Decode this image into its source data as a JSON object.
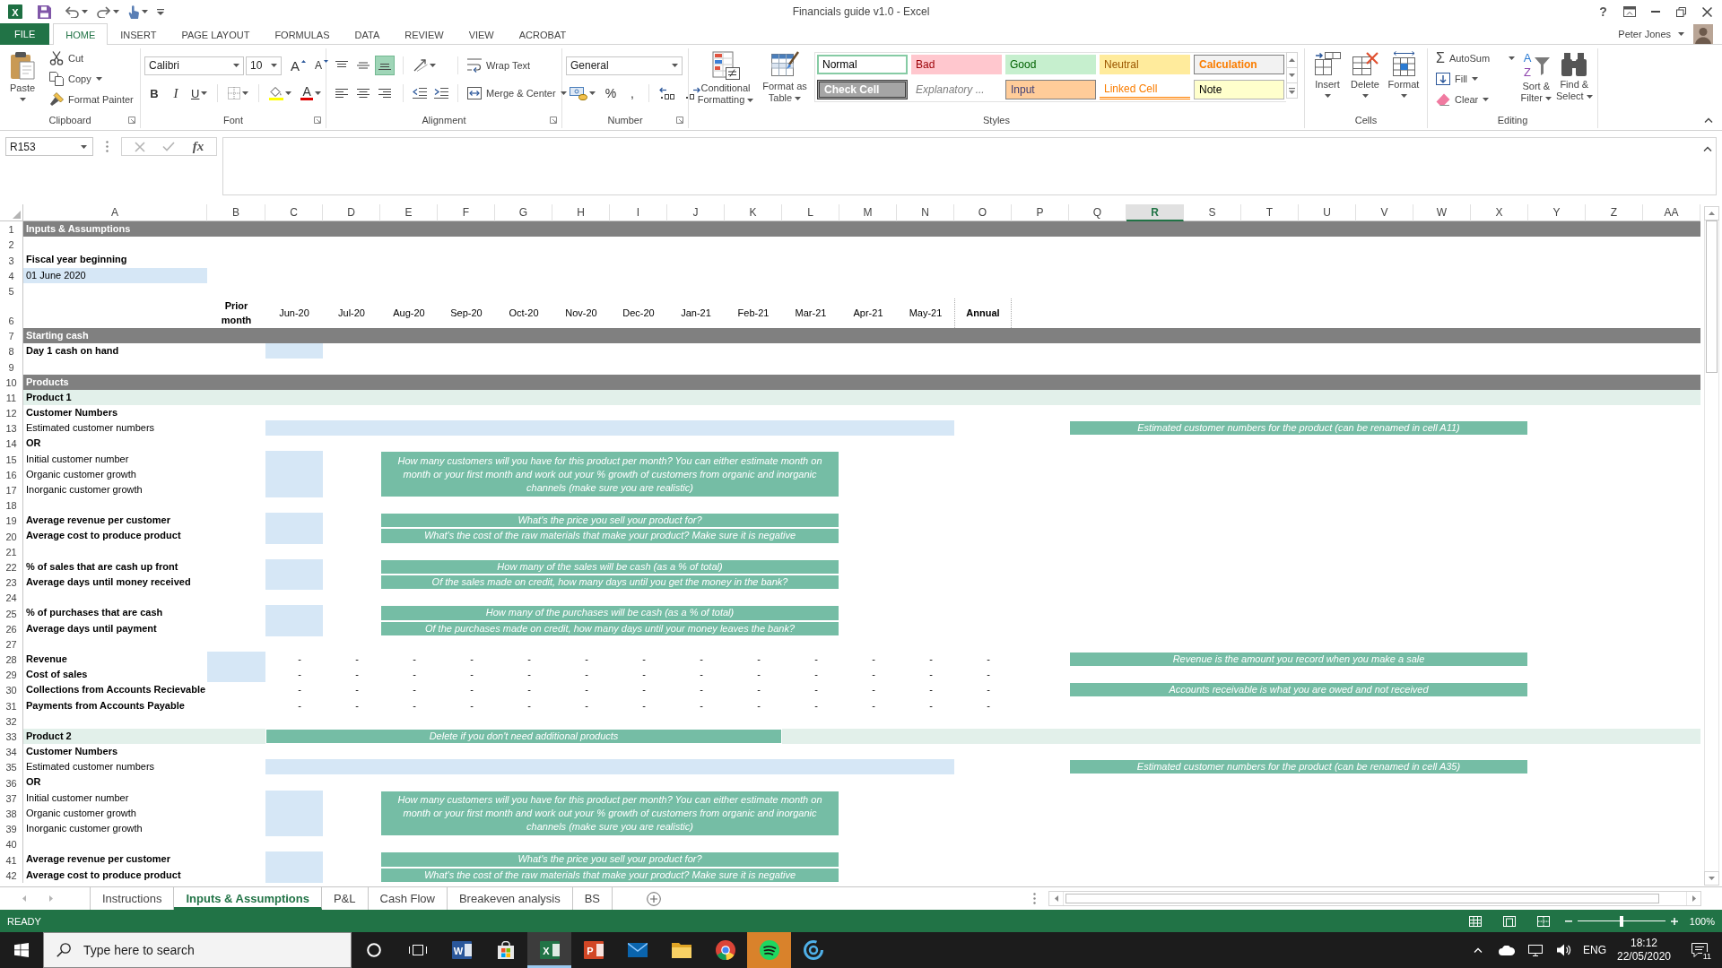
{
  "window": {
    "app_glyph": "X",
    "title": "Financials guide v1.0 - Excel",
    "help": "?"
  },
  "ribbon": {
    "tabs": [
      {
        "label": "FILE",
        "kind": "file",
        "selected": false
      },
      {
        "label": "HOME",
        "kind": "tab",
        "selected": true
      },
      {
        "label": "INSERT",
        "kind": "tab",
        "selected": false
      },
      {
        "label": "PAGE LAYOUT",
        "kind": "tab",
        "selected": false
      },
      {
        "label": "FORMULAS",
        "kind": "tab",
        "selected": false
      },
      {
        "label": "DATA",
        "kind": "tab",
        "selected": false
      },
      {
        "label": "REVIEW",
        "kind": "tab",
        "selected": false
      },
      {
        "label": "VIEW",
        "kind": "tab",
        "selected": false
      },
      {
        "label": "ACROBAT",
        "kind": "tab",
        "selected": false
      }
    ],
    "user": "Peter Jones",
    "clipboard": {
      "label": "Clipboard",
      "paste": "Paste",
      "cut": "Cut",
      "copy": "Copy",
      "format_painter": "Format Painter"
    },
    "font": {
      "label": "Font",
      "family": "Calibri",
      "size": "10",
      "grow_glyph": "A",
      "shrink_glyph": "A",
      "bold_glyph": "B",
      "italic_glyph": "I",
      "underline_glyph": "U",
      "font_color_glyph": "A"
    },
    "alignment": {
      "label": "Alignment",
      "vertical": [
        {
          "selected": false
        },
        {
          "selected": false
        },
        {
          "selected": true
        }
      ],
      "horizontal": [
        {
          "selected": false
        },
        {
          "selected": false
        },
        {
          "selected": false
        }
      ],
      "wrap_text": "Wrap Text",
      "merge_center": "Merge & Center"
    },
    "number": {
      "label": "Number",
      "format": "General",
      "percent": "%",
      "comma": ","
    },
    "styles": {
      "label": "Styles",
      "conditional_formatting": "Conditional Formatting",
      "format_as_table": "Format as Table",
      "cell_styles": [
        {
          "label": "Normal",
          "kind": "normal",
          "selected": true
        },
        {
          "label": "Bad",
          "kind": "bad",
          "selected": false
        },
        {
          "label": "Good",
          "kind": "good",
          "selected": false
        },
        {
          "label": "Neutral",
          "kind": "neutral",
          "selected": false
        },
        {
          "label": "Calculation",
          "kind": "calculation",
          "selected": false
        },
        {
          "label": "Check Cell",
          "kind": "check",
          "selected": false
        },
        {
          "label": "Explanatory ...",
          "kind": "explanatory",
          "selected": false
        },
        {
          "label": "Input",
          "kind": "input",
          "selected": false
        },
        {
          "label": "Linked Cell",
          "kind": "linked",
          "selected": false
        },
        {
          "label": "Note",
          "kind": "note",
          "selected": false
        }
      ]
    },
    "cells": {
      "label": "Cells",
      "insert": "Insert",
      "delete": "Delete",
      "format": "Format"
    },
    "editing": {
      "label": "Editing",
      "sum_glyph": "Σ",
      "autosum": "AutoSum",
      "fill": "Fill",
      "clear": "Clear",
      "sort_filter": "Sort & Filter",
      "sort_glyphs": [
        "A",
        "Z"
      ],
      "find_select": "Find & Select"
    }
  },
  "formula_bar": {
    "name_box": "R153",
    "fx_glyph": "fx"
  },
  "sheet": {
    "columns": [
      {
        "label": "A",
        "selected": false
      },
      {
        "label": "B",
        "selected": false
      },
      {
        "label": "C",
        "selected": false
      },
      {
        "label": "D",
        "selected": false
      },
      {
        "label": "E",
        "selected": false
      },
      {
        "label": "F",
        "selected": false
      },
      {
        "label": "G",
        "selected": false
      },
      {
        "label": "H",
        "selected": false
      },
      {
        "label": "I",
        "selected": false
      },
      {
        "label": "J",
        "selected": false
      },
      {
        "label": "K",
        "selected": false
      },
      {
        "label": "L",
        "selected": false
      },
      {
        "label": "M",
        "selected": false
      },
      {
        "label": "N",
        "selected": false
      },
      {
        "label": "O",
        "selected": false
      },
      {
        "label": "P",
        "selected": false
      },
      {
        "label": "Q",
        "selected": false
      },
      {
        "label": "R",
        "selected": true
      },
      {
        "label": "S",
        "selected": false
      },
      {
        "label": "T",
        "selected": false
      },
      {
        "label": "U",
        "selected": false
      },
      {
        "label": "V",
        "selected": false
      },
      {
        "label": "W",
        "selected": false
      },
      {
        "label": "X",
        "selected": false
      },
      {
        "label": "Y",
        "selected": false
      },
      {
        "label": "Z",
        "selected": false
      },
      {
        "label": "AA",
        "selected": false
      }
    ],
    "rows": [
      {
        "kind": "section",
        "number": "1",
        "label": "Inputs & Assumptions"
      },
      {
        "kind": "blank",
        "number": "2"
      },
      {
        "kind": "text",
        "number": "3",
        "label": "Fiscal year beginning",
        "bold": true
      },
      {
        "kind": "date",
        "number": "4",
        "value": "01 June 2020"
      },
      {
        "kind": "blank",
        "number": "5"
      },
      {
        "kind": "months",
        "number": "6",
        "prior": "Prior month",
        "months": [
          "Jun-20",
          "Jul-20",
          "Aug-20",
          "Sep-20",
          "Oct-20",
          "Nov-20",
          "Dec-20",
          "Jan-21",
          "Feb-21",
          "Mar-21",
          "Apr-21",
          "May-21"
        ],
        "total": "Annual"
      },
      {
        "kind": "section",
        "number": "7",
        "label": "Starting cash"
      },
      {
        "kind": "input",
        "number": "8",
        "label": "Day 1 cash on hand",
        "bold": true
      },
      {
        "kind": "blank",
        "number": "9"
      },
      {
        "kind": "section",
        "number": "10",
        "label": "Products"
      },
      {
        "kind": "product",
        "number": "11",
        "label": "Product 1",
        "bold": true
      },
      {
        "kind": "text",
        "number": "12",
        "label": "Customer Numbers",
        "bold": true
      },
      {
        "kind": "estimate",
        "number": "13",
        "label": "Estimated customer numbers",
        "bold": false,
        "note": "Estimated customer numbers for the product (can be renamed in cell A11)"
      },
      {
        "kind": "text",
        "number": "14",
        "label": "OR",
        "bold": true
      },
      {
        "kind": "block",
        "note": "How many customers will you have for this product per month? You can either estimate month on month or your first month and work out your % growth of customers from organic and inorganic channels (make sure you are realistic)",
        "rows": [
          {
            "kind": "input",
            "number": "15",
            "label": "Initial customer number",
            "bold": false
          },
          {
            "kind": "input",
            "number": "16",
            "label": "Organic customer growth",
            "bold": false
          },
          {
            "kind": "input",
            "number": "17",
            "label": "Inorganic customer growth",
            "bold": false
          }
        ]
      },
      {
        "kind": "blank",
        "number": "18"
      },
      {
        "kind": "input",
        "number": "19",
        "label": "Average revenue per customer",
        "bold": true,
        "note": "What's the price you sell your product for?"
      },
      {
        "kind": "input",
        "number": "20",
        "label": "Average cost to produce product",
        "bold": true,
        "note": "What's the cost of the raw materials that make your product? Make sure it is negative"
      },
      {
        "kind": "blank",
        "number": "21"
      },
      {
        "kind": "input",
        "number": "22",
        "label": "% of sales that are cash up front",
        "bold": true,
        "note": "How many of the sales will be cash (as a % of total)"
      },
      {
        "kind": "input",
        "number": "23",
        "label": "Average days until money received",
        "bold": true,
        "note": "Of the sales made on credit, how many days until you get the money in the bank?"
      },
      {
        "kind": "blank",
        "number": "24"
      },
      {
        "kind": "input",
        "number": "25",
        "label": "% of purchases that are cash",
        "bold": true,
        "note": "How many of the purchases will be cash (as a % of total)"
      },
      {
        "kind": "input",
        "number": "26",
        "label": "Average days until payment",
        "bold": true,
        "note": "Of the purchases made on credit, how many days until your money leaves the bank?"
      },
      {
        "kind": "blank",
        "number": "27"
      },
      {
        "kind": "values",
        "number": "28",
        "label": "Revenue",
        "bold": true,
        "input": true,
        "values": [
          "-",
          "-",
          "-",
          "-",
          "-",
          "-",
          "-",
          "-",
          "-",
          "-",
          "-",
          "-",
          "-"
        ],
        "note": "Revenue is the amount you record when you make a sale"
      },
      {
        "kind": "values",
        "number": "29",
        "label": "Cost of sales",
        "bold": true,
        "input": true,
        "values": [
          "-",
          "-",
          "-",
          "-",
          "-",
          "-",
          "-",
          "-",
          "-",
          "-",
          "-",
          "-",
          "-"
        ]
      },
      {
        "kind": "values",
        "number": "30",
        "label": "Collections from Accounts Recievable",
        "bold": true,
        "input": false,
        "values": [
          "-",
          "-",
          "-",
          "-",
          "-",
          "-",
          "-",
          "-",
          "-",
          "-",
          "-",
          "-",
          "-"
        ],
        "note": "Accounts receivable is what you are owed and not received"
      },
      {
        "kind": "values",
        "number": "31",
        "label": "Payments from Accounts Payable",
        "bold": true,
        "input": false,
        "values": [
          "-",
          "-",
          "-",
          "-",
          "-",
          "-",
          "-",
          "-",
          "-",
          "-",
          "-",
          "-",
          "-"
        ]
      },
      {
        "kind": "blank",
        "number": "32"
      },
      {
        "kind": "product",
        "number": "33",
        "label": "Product 2",
        "bold": true,
        "note": "Delete if you don't need additional products"
      },
      {
        "kind": "text",
        "number": "34",
        "label": "Customer Numbers",
        "bold": true
      },
      {
        "kind": "estimate",
        "number": "35",
        "label": "Estimated customer numbers",
        "bold": false,
        "note": "Estimated customer numbers for the product (can be renamed in cell A35)"
      },
      {
        "kind": "text",
        "number": "36",
        "label": "OR",
        "bold": true
      },
      {
        "kind": "block",
        "note": "How many customers will you have for this product per month? You can either estimate month on month or your first month and work out your % growth of customers from organic and inorganic channels (make sure you are realistic)",
        "rows": [
          {
            "kind": "input",
            "number": "37",
            "label": "Initial customer number",
            "bold": false
          },
          {
            "kind": "input",
            "number": "38",
            "label": "Organic customer growth",
            "bold": false
          },
          {
            "kind": "input",
            "number": "39",
            "label": "Inorganic customer growth",
            "bold": false
          }
        ]
      },
      {
        "kind": "blank",
        "number": "40"
      },
      {
        "kind": "input",
        "number": "41",
        "label": "Average revenue per customer",
        "bold": true,
        "note": "What's the price you sell your product for?"
      },
      {
        "kind": "input",
        "number": "42",
        "label": "Average cost to produce product",
        "bold": true,
        "note": "What's the cost of the raw materials that make your product? Make sure it is negative"
      }
    ]
  },
  "sheet_tabs": [
    {
      "label": "Instructions",
      "selected": false
    },
    {
      "label": "Inputs & Assumptions",
      "selected": true
    },
    {
      "label": "P&L",
      "selected": false
    },
    {
      "label": "Cash Flow",
      "selected": false
    },
    {
      "label": "Breakeven analysis",
      "selected": false
    },
    {
      "label": "BS",
      "selected": false
    }
  ],
  "status_bar": {
    "mode": "READY",
    "zoom_slider": {
      "level": 0.5
    },
    "zoom": "100%"
  },
  "taskbar": {
    "search_placeholder": "Type here to search",
    "apps": [
      {
        "kind": "word",
        "glyph": "W",
        "selected": false,
        "flashing": false
      },
      {
        "kind": "store",
        "selected": false,
        "flashing": false
      },
      {
        "kind": "excel",
        "glyph": "X",
        "selected": true,
        "flashing": false
      },
      {
        "kind": "powerpoint",
        "glyph": "P",
        "selected": false,
        "flashing": false
      },
      {
        "kind": "mail",
        "selected": false,
        "flashing": false
      },
      {
        "kind": "explorer",
        "selected": false,
        "flashing": false
      },
      {
        "kind": "chrome",
        "selected": false,
        "flashing": false
      },
      {
        "kind": "spotify",
        "selected": false,
        "flashing": true
      },
      {
        "kind": "app",
        "selected": false,
        "flashing": false
      }
    ],
    "language": "ENG",
    "time": "18:12",
    "date": "22/05/2020",
    "notifications": "11"
  }
}
